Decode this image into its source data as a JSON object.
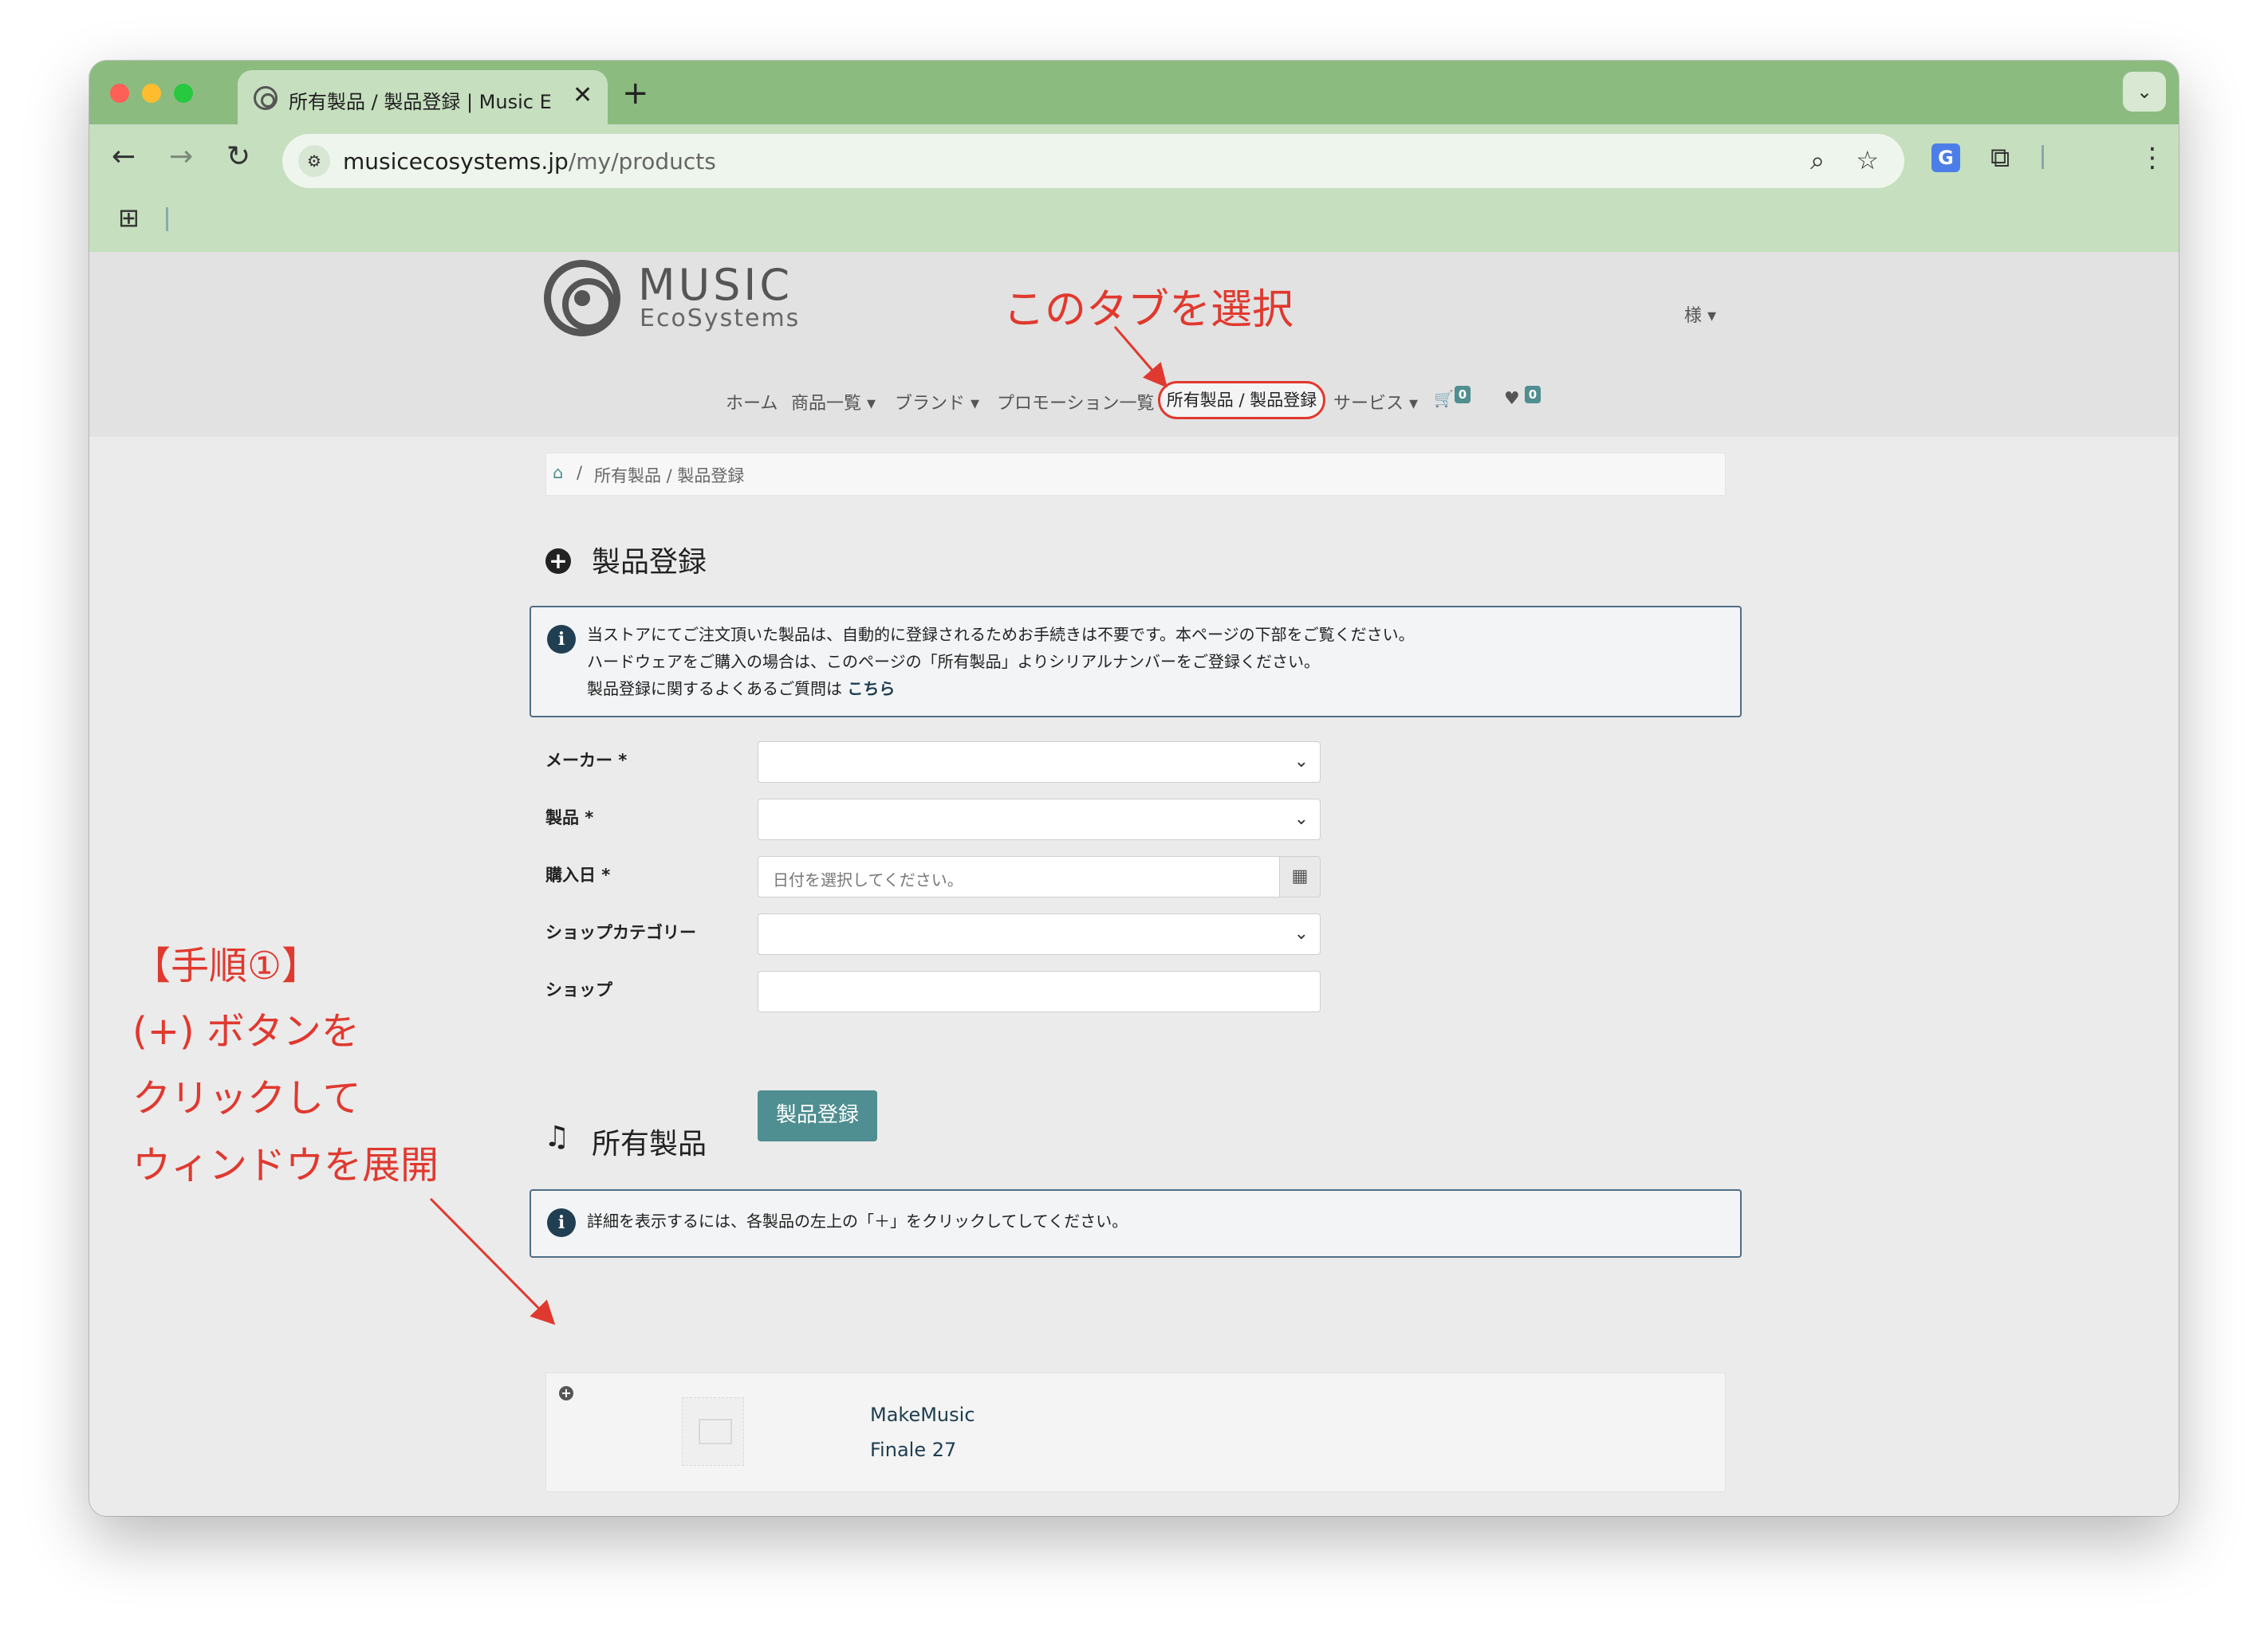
{
  "browser": {
    "tab_title": "所有製品 / 製品登録 | Music Eco",
    "tab_close": "✕",
    "new_tab": "+",
    "tab_menu": "⌄",
    "url_domain": "musicecosystems.jp",
    "url_path": "/my/products",
    "back": "←",
    "forward": "→",
    "reload": "↻",
    "site_info": "⚙",
    "zoom": "⌕",
    "star": "☆",
    "translate": "G",
    "extensions": "⧉",
    "menu": "⋮",
    "apps": "⊞"
  },
  "site": {
    "logo_music": "MUSIC",
    "logo_eco": "EcoSystems",
    "user_menu": "様 ▾",
    "nav": {
      "home": "ホーム",
      "products": "商品一覧 ▾",
      "brands": "ブランド ▾",
      "promotions": "プロモーション一覧",
      "owned": "所有製品 / 製品登録",
      "services": "サービス ▾",
      "cart_icon": "🛒",
      "cart_count": "0",
      "wishlist_icon": "♥",
      "wishlist_count": "0"
    },
    "breadcrumb": {
      "home_icon": "⌂",
      "separator": "/",
      "current": "所有製品 / 製品登録"
    }
  },
  "register": {
    "title": "製品登録",
    "icon": "+",
    "info_lines": [
      "当ストアにてご注文頂いた製品は、自動的に登録されるためお手続きは不要です。本ページの下部をご覧ください。",
      "ハードウェアをご購入の場合は、このページの「所有製品」よりシリアルナンバーをご登録ください。",
      "製品登録に関するよくあるご質問は"
    ],
    "info_link": "こちら",
    "fields": {
      "maker_label": "メーカー *",
      "product_label": "製品 *",
      "date_label": "購入日 *",
      "date_placeholder": "日付を選択してください。",
      "shop_category_label": "ショップカテゴリー",
      "shop_label": "ショップ"
    },
    "submit": "製品登録"
  },
  "owned": {
    "title": "所有製品",
    "icon": "♫",
    "info": "詳細を表示するには、各製品の左上の「＋」をクリックしてしてください。",
    "products": [
      {
        "maker": "MakeMusic",
        "name": "Finale 27"
      }
    ]
  },
  "annotations": {
    "tab_hint": "このタブを選択",
    "step_title": "【手順①】",
    "step_line1": "(+) ボタンを",
    "step_line2": "クリックして",
    "step_line3": "ウィンドウを展開"
  },
  "colors": {
    "browser_chrome": "#8cbb80",
    "toolbar": "#c6dfbf",
    "accent_teal": "#4f8e91",
    "annotation_red": "#e0392f"
  }
}
